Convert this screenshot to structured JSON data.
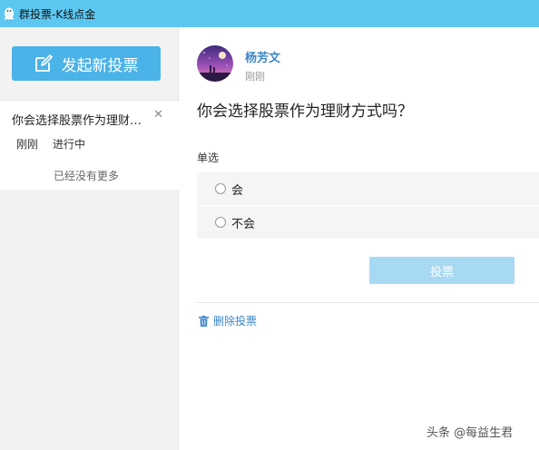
{
  "window": {
    "title": "群投票-K线点金"
  },
  "sidebar": {
    "new_vote_label": "发起新投票",
    "items": [
      {
        "title": "你会选择股票作为理财方式吗？",
        "time": "刚刚",
        "status": "进行中"
      }
    ],
    "no_more_text": "已经没有更多"
  },
  "vote": {
    "author": "杨芳文",
    "time": "刚刚",
    "question": "你会选择股票作为理财方式吗？",
    "type_label": "单选",
    "options": [
      {
        "label": "会"
      },
      {
        "label": "不会"
      }
    ],
    "submit_label": "投票",
    "delete_label": "删除投票"
  },
  "watermark": "头条 @每益生君",
  "colors": {
    "titlebar": "#5cc8f2",
    "primary_button": "#4ab3e8",
    "vote_button_disabled": "#a8d9f2",
    "link": "#3a86c8"
  },
  "icons": {
    "app": "qq-penguin-icon",
    "new_vote": "edit-icon",
    "close": "close-icon",
    "delete": "trash-icon"
  }
}
